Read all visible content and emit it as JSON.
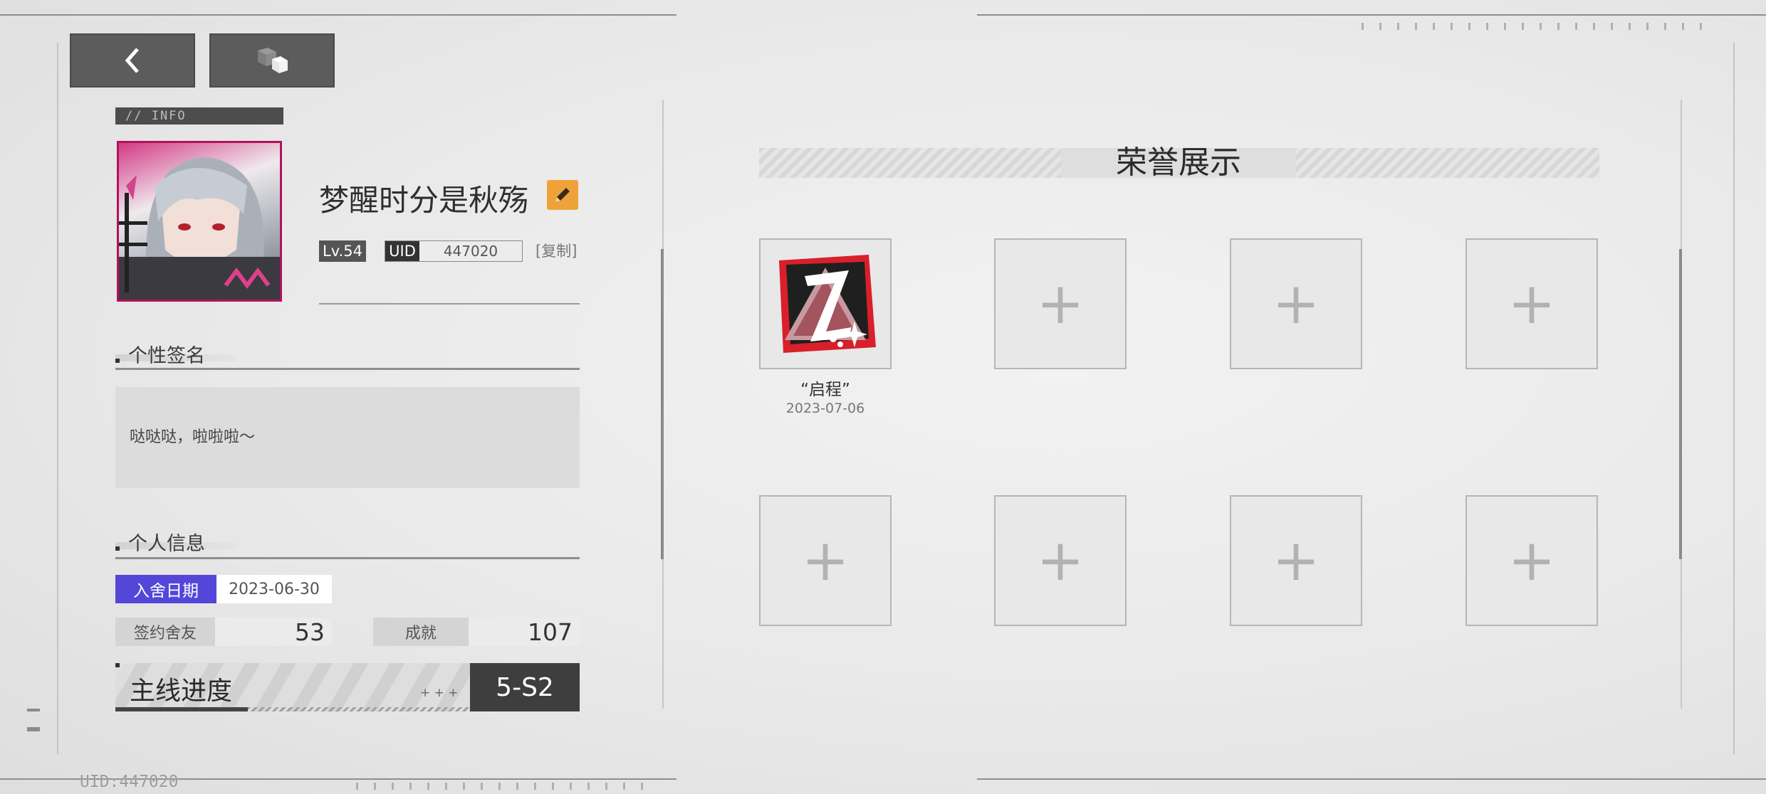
{
  "info_tag": "// INFO",
  "player": {
    "name": "梦醒时分是秋殇",
    "level": "Lv.54",
    "uid_label": "UID",
    "uid": "447020",
    "copy_label": "[复制]"
  },
  "signature": {
    "title": "个性签名",
    "text": "哒哒哒，啦啦啦～"
  },
  "personal_info": {
    "title": "个人信息",
    "join_date_label": "入舍日期",
    "join_date": "2023-06-30",
    "friends_label": "签约舍友",
    "friends": "53",
    "achievements_label": "成就",
    "achievements": "107"
  },
  "progress": {
    "label": "主线进度",
    "marks": "+ + +",
    "value": "5-S2"
  },
  "honor": {
    "title": "荣誉展示",
    "medals": [
      {
        "name": "“启程”",
        "date": "2023-07-06"
      }
    ],
    "empty_slot_symbol": "+"
  },
  "bottom_uid": "UID:447020",
  "colors": {
    "accent_purple": "#5446d8",
    "edit_orange": "#f0a23a",
    "avatar_border": "#b3125c",
    "medal_red": "#d8202a"
  },
  "icons": {
    "back": "chevron-left-icon",
    "switch": "cubes-icon",
    "edit": "pencil-icon"
  }
}
